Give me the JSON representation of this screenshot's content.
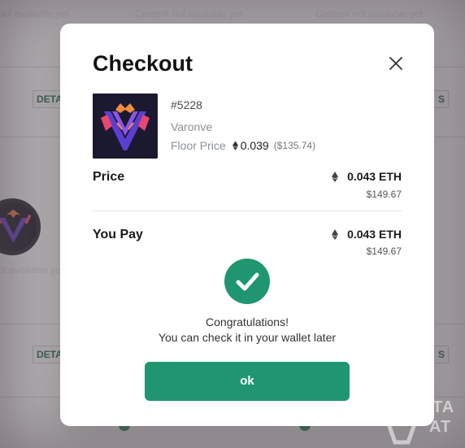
{
  "background": {
    "unavailable_text": "Content not available yet",
    "unavailable_text_short": "not available yet",
    "unavailable_text_short_2": "ot available ye",
    "details_label_left": "DETA",
    "details_label_right": "S"
  },
  "modal": {
    "title": "Checkout",
    "close_icon": "close-icon"
  },
  "nft": {
    "id": "#5228",
    "collection": "Varonve",
    "floor_label": "Floor Price",
    "floor_value": "0.039",
    "floor_usd": "($135.74)"
  },
  "price": {
    "label": "Price",
    "eth": "0.043 ETH",
    "usd": "$149.67"
  },
  "pay": {
    "label": "You Pay",
    "eth": "0.043 ETH",
    "usd": "$149.67"
  },
  "success": {
    "line1": "Congratulations!",
    "line2": "You can check it in your wallet later"
  },
  "ok_button": {
    "label": "ok"
  },
  "watermark": {
    "line1": "TA",
    "line2": "AT"
  },
  "colors": {
    "accent": "#1f9670",
    "text": "#1a1a1a",
    "muted": "#8a9096"
  }
}
